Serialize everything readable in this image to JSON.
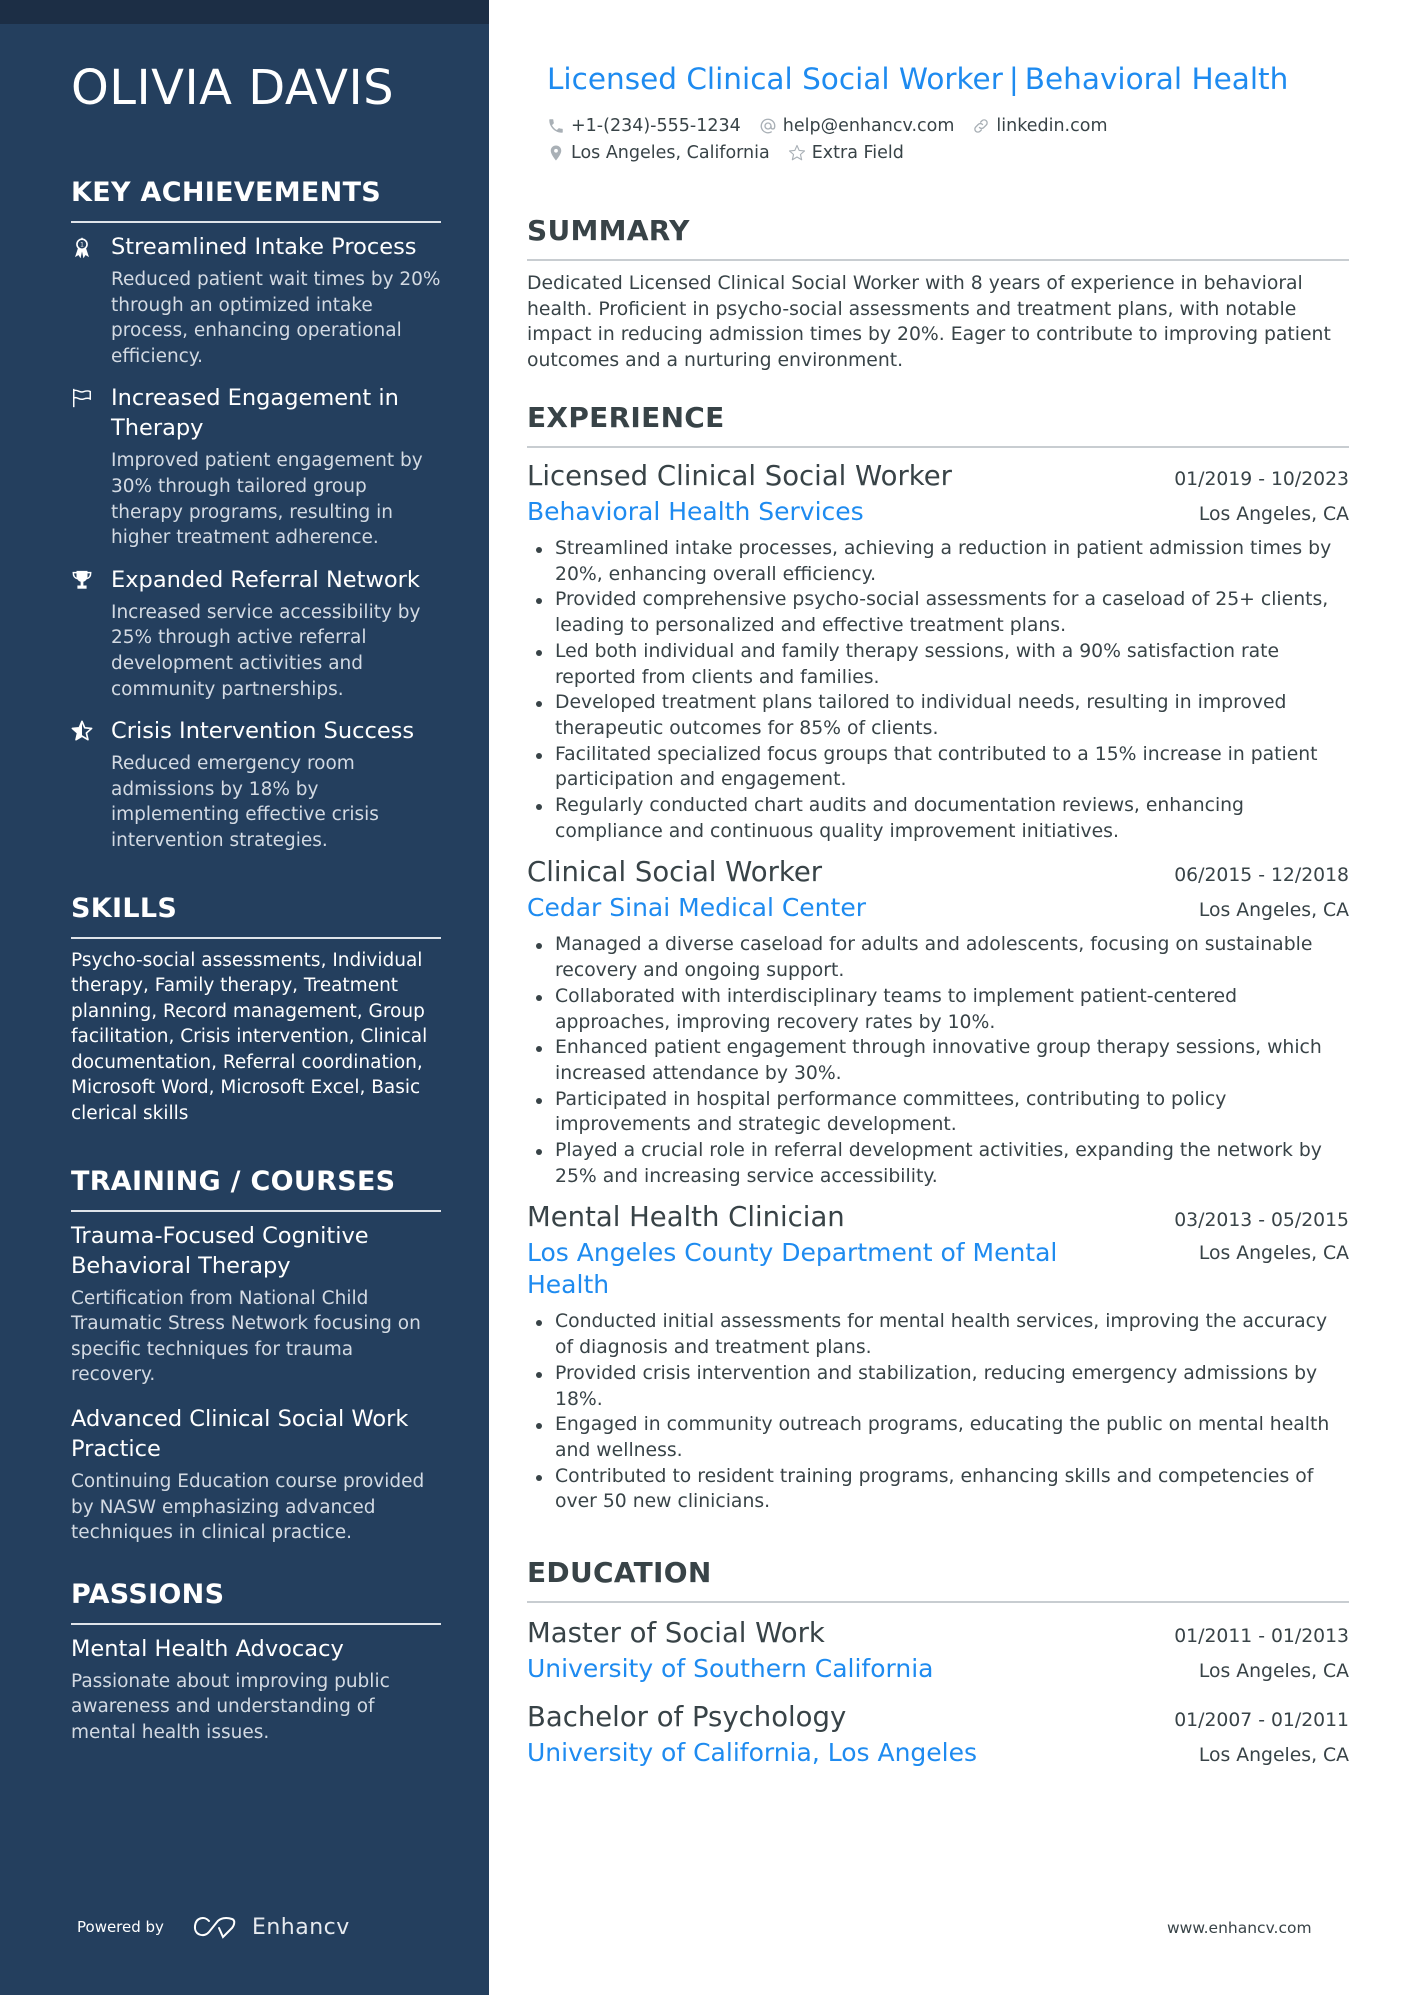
{
  "sidebar": {
    "name": "OLIVIA DAVIS",
    "achievements": {
      "heading": "KEY ACHIEVEMENTS",
      "items": [
        {
          "icon": "award-ribbon-icon",
          "title": "Streamlined Intake Process",
          "description": "Reduced patient wait times by 20% through an optimized intake process, enhancing operational efficiency."
        },
        {
          "icon": "flag-icon",
          "title": "Increased Engagement in Therapy",
          "description": "Improved patient engagement by 30% through tailored group therapy programs, resulting in higher treatment adherence."
        },
        {
          "icon": "trophy-icon",
          "title": "Expanded Referral Network",
          "description": "Increased service accessibility by 25% through active referral development activities and community partnerships."
        },
        {
          "icon": "half-star-icon",
          "title": "Crisis Intervention Success",
          "description": "Reduced emergency room admissions by 18% by implementing effective crisis intervention strategies."
        }
      ]
    },
    "skills": {
      "heading": "SKILLS",
      "text": "Psycho-social assessments, Individual therapy, Family therapy, Treatment planning, Record management, Group facilitation, Crisis intervention, Clinical documentation, Referral coordination, Microsoft Word, Microsoft Excel, Basic clerical skills"
    },
    "training": {
      "heading": "TRAINING / COURSES",
      "items": [
        {
          "title": "Trauma-Focused Cognitive Behavioral Therapy",
          "description": "Certification from National Child Traumatic Stress Network focusing on specific techniques for trauma recovery."
        },
        {
          "title": "Advanced Clinical Social Work Practice",
          "description": "Continuing Education course provided by NASW emphasizing advanced techniques in clinical practice."
        }
      ]
    },
    "passions": {
      "heading": "PASSIONS",
      "items": [
        {
          "title": "Mental Health Advocacy",
          "description": "Passionate about improving public awareness and understanding of mental health issues."
        }
      ]
    },
    "powered_by": {
      "label": "Powered by",
      "brand": "Enhancv"
    }
  },
  "header": {
    "title_part1": "Licensed Clinical Social Worker",
    "title_separator": "|",
    "title_part2": "Behavioral Health",
    "contacts": {
      "phone": "+1-(234)-555-1234",
      "email": "help@enhancv.com",
      "website": "linkedin.com",
      "location": "Los Angeles, California",
      "extra": "Extra Field"
    }
  },
  "summary": {
    "heading": "SUMMARY",
    "text": "Dedicated Licensed Clinical Social Worker with 8 years of experience in behavioral health. Proficient in psycho-social assessments and treatment plans, with notable impact in reducing admission times by 20%. Eager to contribute to improving patient outcomes and a nurturing environment."
  },
  "experience": {
    "heading": "EXPERIENCE",
    "jobs": [
      {
        "title": "Licensed Clinical Social Worker",
        "dates": "01/2019 - 10/2023",
        "company": "Behavioral Health Services",
        "location": "Los Angeles, CA",
        "bullets": [
          "Streamlined intake processes, achieving a reduction in patient admission times by 20%, enhancing overall efficiency.",
          "Provided comprehensive psycho-social assessments for a caseload of 25+ clients, leading to personalized and effective treatment plans.",
          "Led both individual and family therapy sessions, with a 90% satisfaction rate reported from clients and families.",
          "Developed treatment plans tailored to individual needs, resulting in improved therapeutic outcomes for 85% of clients.",
          "Facilitated specialized focus groups that contributed to a 15% increase in patient participation and engagement.",
          "Regularly conducted chart audits and documentation reviews, enhancing compliance and continuous quality improvement initiatives."
        ]
      },
      {
        "title": "Clinical Social Worker",
        "dates": "06/2015 - 12/2018",
        "company": "Cedar Sinai Medical Center",
        "location": "Los Angeles, CA",
        "bullets": [
          "Managed a diverse caseload for adults and adolescents, focusing on sustainable recovery and ongoing support.",
          "Collaborated with interdisciplinary teams to implement patient-centered approaches, improving recovery rates by 10%.",
          "Enhanced patient engagement through innovative group therapy sessions, which increased attendance by 30%.",
          "Participated in hospital performance committees, contributing to policy improvements and strategic development.",
          "Played a crucial role in referral development activities, expanding the network by 25% and increasing service accessibility."
        ]
      },
      {
        "title": "Mental Health Clinician",
        "dates": "03/2013 - 05/2015",
        "company": "Los Angeles County Department of Mental Health",
        "location": "Los Angeles, CA",
        "bullets": [
          "Conducted initial assessments for mental health services, improving the accuracy of diagnosis and treatment plans.",
          "Provided crisis intervention and stabilization, reducing emergency admissions by 18%.",
          "Engaged in community outreach programs, educating the public on mental health and wellness.",
          "Contributed to resident training programs, enhancing skills and competencies of over 50 new clinicians."
        ]
      }
    ]
  },
  "education": {
    "heading": "EDUCATION",
    "items": [
      {
        "degree": "Master of Social Work",
        "dates": "01/2011 - 01/2013",
        "school": "University of Southern California",
        "location": "Los Angeles, CA"
      },
      {
        "degree": "Bachelor of Psychology",
        "dates": "01/2007 - 01/2011",
        "school": "University of California, Los Angeles",
        "location": "Los Angeles, CA"
      }
    ]
  },
  "footer": {
    "url": "www.enhancv.com"
  },
  "colors": {
    "sidebar_bg": "#243f5e",
    "sidebar_top": "#1c2e45",
    "accent": "#1e8bf0",
    "text": "#384347"
  }
}
